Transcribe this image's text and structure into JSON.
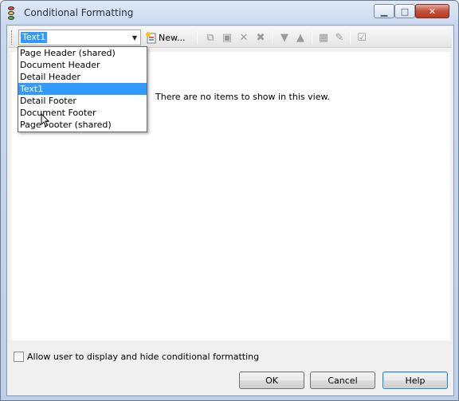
{
  "window": {
    "title": "Conditional Formatting"
  },
  "toolbar": {
    "combo_value": "Text1",
    "new_label": "New...",
    "icons": [
      "copy-icon",
      "paste-icon",
      "delete-icon",
      "delete-all-icon",
      "move-down-icon",
      "move-up-icon",
      "properties-icon",
      "clear-icon",
      "edit-icon"
    ]
  },
  "dropdown": {
    "items": [
      "Page Header (shared)",
      "Document Header",
      "Detail Header",
      "Text1",
      "Detail Footer",
      "Document Footer",
      "Page Footer (shared)"
    ],
    "selected": "Text1"
  },
  "list": {
    "empty_message": "There are no items to show in this view."
  },
  "checkbox": {
    "label": "Allow user to display and hide conditional formatting",
    "checked": false
  },
  "buttons": {
    "ok": "OK",
    "cancel": "Cancel",
    "help": "Help"
  },
  "colors": {
    "selection": "#3399ff",
    "close_button": "#c4503b"
  }
}
